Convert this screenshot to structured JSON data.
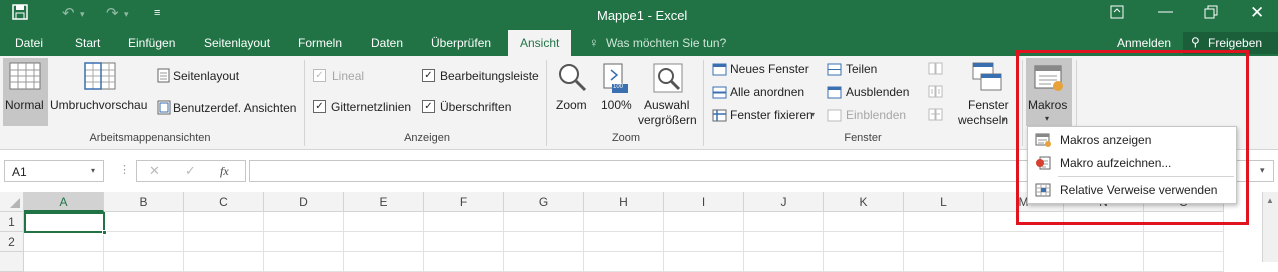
{
  "titlebar": {
    "title": "Mappe1 - Excel"
  },
  "tabs": [
    "Datei",
    "Start",
    "Einfügen",
    "Seitenlayout",
    "Formeln",
    "Daten",
    "Überprüfen",
    "Ansicht"
  ],
  "tellme": "Was möchten Sie tun?",
  "account": {
    "user": "Anmelden",
    "share": "Freigeben"
  },
  "ribbon": {
    "workbook_views": {
      "normal": "Normal",
      "pagebreak": "Umbruchvorschau",
      "pagelayout": "Seitenlayout",
      "custom": "Benutzerdef. Ansichten",
      "label": "Arbeitsmappenansichten"
    },
    "show": {
      "ruler": "Lineal",
      "formula_bar": "Bearbeitungsleiste",
      "gridlines": "Gitternetzlinien",
      "headings": "Überschriften",
      "label": "Anzeigen"
    },
    "zoom": {
      "zoom": "Zoom",
      "hundred": "100%",
      "selection_1": "Auswahl",
      "selection_2": "vergrößern",
      "label": "Zoom",
      "badge": "100"
    },
    "window": {
      "new": "Neues Fenster",
      "arrange": "Alle anordnen",
      "freeze": "Fenster fixieren",
      "split": "Teilen",
      "hide": "Ausblenden",
      "unhide": "Einblenden",
      "switch_1": "Fenster",
      "switch_2": "wechseln",
      "label": "Fenster"
    },
    "macros": {
      "label": "Makros"
    }
  },
  "formulabar": {
    "namebox": "A1",
    "fx": "fx"
  },
  "grid": {
    "columns": [
      "A",
      "B",
      "C",
      "D",
      "E",
      "F",
      "G",
      "H",
      "I",
      "J",
      "K",
      "L",
      "M",
      "N",
      "O"
    ],
    "rows": [
      "1",
      "2"
    ]
  },
  "macro_menu": [
    "Makros anzeigen",
    "Makro aufzeichnen...",
    "Relative Verweise verwenden"
  ]
}
